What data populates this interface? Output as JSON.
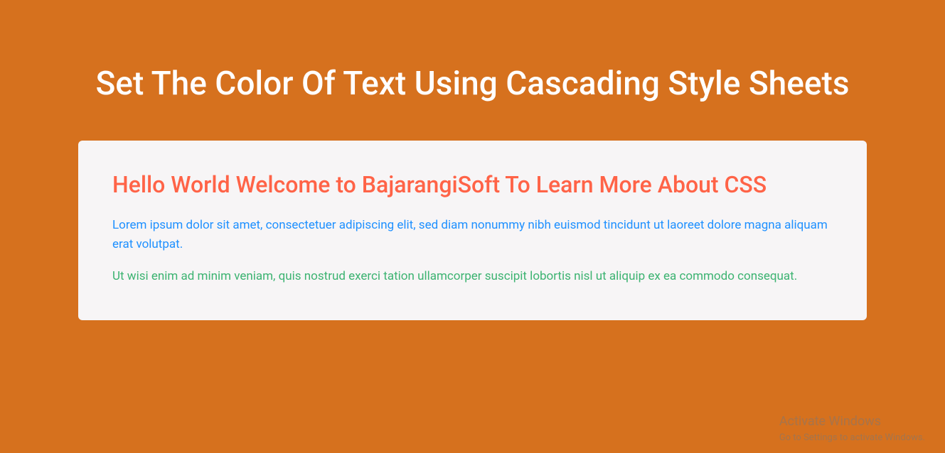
{
  "title": "Set The Color Of Text Using Cascading Style Sheets",
  "card": {
    "heading": "Hello World Welcome to BajarangiSoft To Learn More About CSS",
    "paragraph1": "Lorem ipsum dolor sit amet, consectetuer adipiscing elit, sed diam nonummy nibh euismod tincidunt ut laoreet dolore magna aliquam erat volutpat.",
    "paragraph2": "Ut wisi enim ad minim veniam, quis nostrud exerci tation ullamcorper suscipit lobortis nisl ut aliquip ex ea commodo consequat."
  },
  "watermark": {
    "title": "Activate Windows",
    "subtitle": "Go to Settings to activate Windows."
  }
}
